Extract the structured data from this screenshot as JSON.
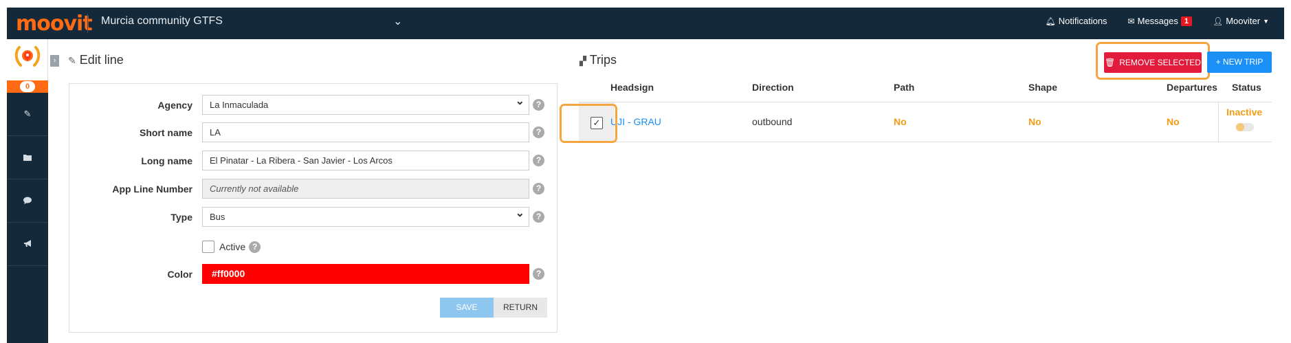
{
  "topbar": {
    "logo": "moovit",
    "project_name": "Murcia community GTFS",
    "notifications_label": "Notifications",
    "messages_label": "Messages",
    "messages_count": "1",
    "user_label": "Mooviter"
  },
  "sidebar": {
    "badge_count": "0",
    "items": [
      "edit-pencil-icon",
      "folder-icon",
      "comment-icon",
      "bullhorn-icon"
    ]
  },
  "edit_line": {
    "title": "Edit line",
    "agency_label": "Agency",
    "agency_value": "La Inmaculada",
    "short_name_label": "Short name",
    "short_name_value": "LA",
    "long_name_label": "Long name",
    "long_name_value": "El Pinatar - La Ribera - San Javier - Los Arcos",
    "app_line_label": "App Line Number",
    "app_line_placeholder": "Currently not available",
    "type_label": "Type",
    "type_value": "Bus",
    "active_label": "Active",
    "color_label": "Color",
    "color_value": "#ff0000",
    "save_label": "SAVE",
    "return_label": "RETURN"
  },
  "trips": {
    "title": "Trips",
    "remove_label": "REMOVE SELECTED",
    "new_trip_label": "+ NEW TRIP",
    "columns": {
      "headsign": "Headsign",
      "direction": "Direction",
      "path": "Path",
      "shape": "Shape",
      "departures": "Departures",
      "status": "Status"
    },
    "rows": [
      {
        "headsign": "UJI - GRAU",
        "direction": "outbound",
        "path": "No",
        "shape": "No",
        "departures": "No",
        "status": "Inactive",
        "selected": true
      }
    ]
  },
  "colors": {
    "accent": "#ff6a13",
    "navbar": "#14293a",
    "danger": "#e21b3c",
    "primary": "#1a8ff5",
    "warning": "#f39c12",
    "highlight": "#f7a541"
  }
}
